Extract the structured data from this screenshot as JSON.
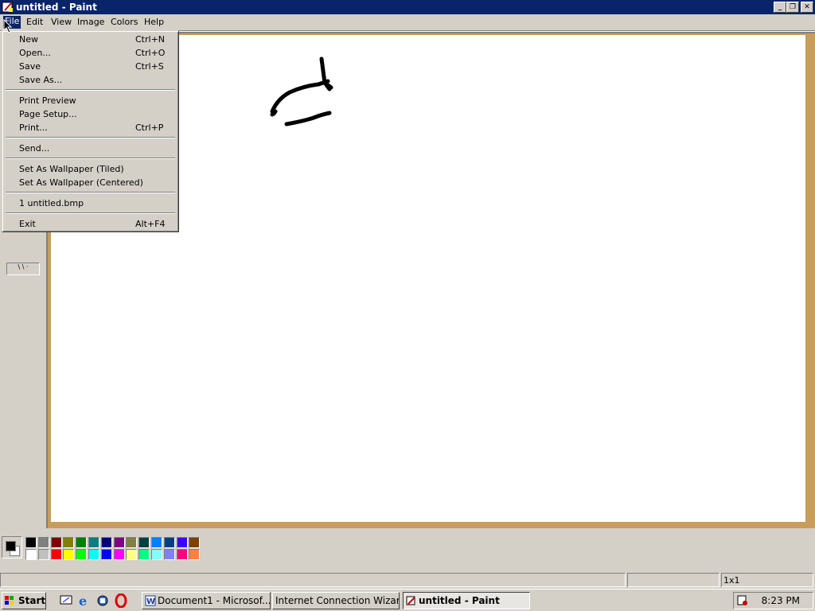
{
  "window": {
    "title": "untitled - Paint",
    "buttons": {
      "minimize": "_",
      "maximize": "❐",
      "close": "✕"
    }
  },
  "menubar": {
    "items": [
      "File",
      "Edit",
      "View",
      "Image",
      "Colors",
      "Help"
    ],
    "active": "File"
  },
  "file_menu": {
    "items": [
      {
        "label": "New",
        "shortcut": "Ctrl+N"
      },
      {
        "label": "Open...",
        "shortcut": "Ctrl+O"
      },
      {
        "label": "Save",
        "shortcut": "Ctrl+S"
      },
      {
        "label": "Save As...",
        "shortcut": ""
      },
      {
        "label": "Print Preview",
        "shortcut": ""
      },
      {
        "label": "Page Setup...",
        "shortcut": ""
      },
      {
        "label": "Print...",
        "shortcut": "Ctrl+P"
      },
      {
        "label": "Send...",
        "shortcut": ""
      },
      {
        "label": "Set As Wallpaper (Tiled)",
        "shortcut": ""
      },
      {
        "label": "Set As Wallpaper (Centered)",
        "shortcut": ""
      },
      {
        "label": "1 untitled.bmp",
        "shortcut": ""
      },
      {
        "label": "Exit",
        "shortcut": "Alt+F4"
      }
    ]
  },
  "palette": {
    "foreground": "#000000",
    "background": "#ffffff",
    "colors_top": [
      "#000000",
      "#808080",
      "#800000",
      "#808000",
      "#008000",
      "#008080",
      "#000080",
      "#800080",
      "#808040",
      "#004040",
      "#0080ff",
      "#004080",
      "#4000ff",
      "#804000"
    ],
    "colors_bottom": [
      "#ffffff",
      "#c0c0c0",
      "#ff0000",
      "#ffff00",
      "#00ff00",
      "#00ffff",
      "#0000ff",
      "#ff00ff",
      "#ffff80",
      "#00ff80",
      "#80ffff",
      "#8080ff",
      "#ff0080",
      "#ff8040"
    ]
  },
  "statusbar": {
    "message": "",
    "coords": "",
    "size": "1x1"
  },
  "taskbar": {
    "start_label": "Start",
    "quicklaunch": [
      "desktop-icon",
      "ie-icon",
      "channels-icon",
      "opera-icon"
    ],
    "tasks": [
      {
        "label": "Document1 - Microsof...",
        "icon": "word-icon",
        "active": false
      },
      {
        "label": "Internet Connection Wizard",
        "icon": "",
        "active": false
      },
      {
        "label": "untitled - Paint",
        "icon": "paint-icon",
        "active": true
      }
    ],
    "clock": "8:23 PM"
  },
  "colors": {
    "titlebar": "#0a246a",
    "face": "#d4d0c8",
    "canvas_bg": "#c89c5a",
    "canvas": "#ffffff"
  }
}
